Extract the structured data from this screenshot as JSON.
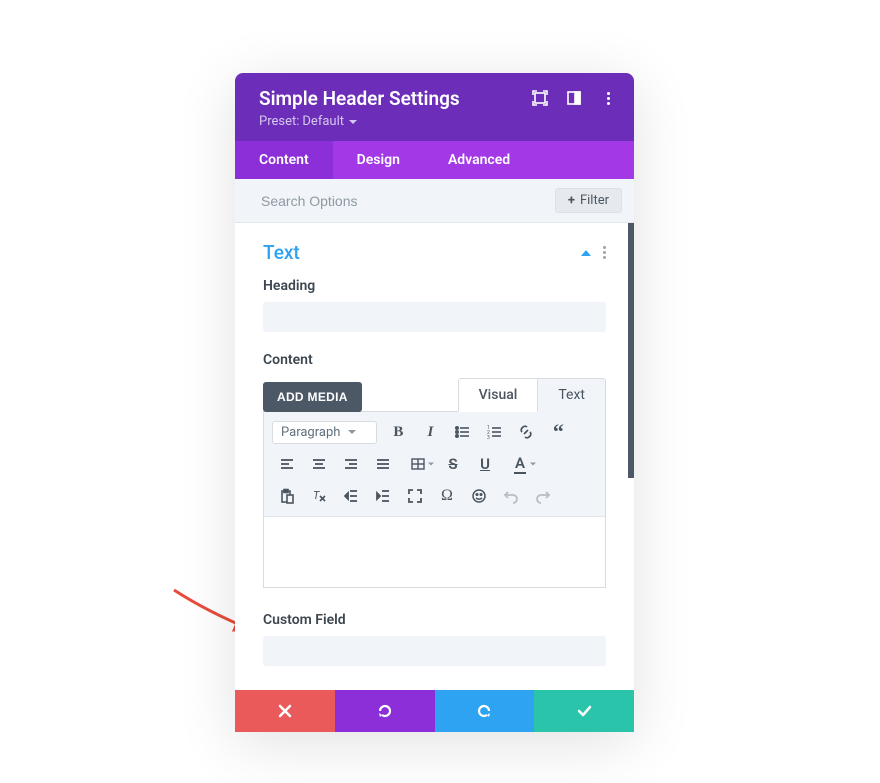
{
  "header": {
    "title": "Simple Header Settings",
    "preset_label": "Preset:",
    "preset_value": "Default"
  },
  "tabs": {
    "content": "Content",
    "design": "Design",
    "advanced": "Advanced"
  },
  "search": {
    "placeholder": "Search Options",
    "filter_label": "Filter"
  },
  "section": {
    "title": "Text",
    "heading_label": "Heading",
    "heading_value": "",
    "content_label": "Content",
    "add_media": "ADD MEDIA",
    "visual_tab": "Visual",
    "text_tab": "Text",
    "format_select": "Paragraph",
    "custom_field_label": "Custom Field",
    "custom_field_value": ""
  },
  "toolbar": {
    "bold": "B",
    "italic": "I",
    "strike": "S",
    "underline": "U",
    "color": "A",
    "omega": "Ω",
    "smiley": "☺"
  },
  "icons": {
    "bullets": "list-bullet",
    "numbers": "list-number",
    "link": "link",
    "quote": "quote",
    "alignL": "align-left",
    "alignC": "align-center",
    "alignR": "align-right",
    "justify": "align-justify",
    "table": "table",
    "paste": "paste",
    "clear": "clear-format",
    "outdent": "outdent",
    "indent": "indent",
    "fullscreen": "fullscreen",
    "undo": "undo",
    "redo": "redo"
  }
}
